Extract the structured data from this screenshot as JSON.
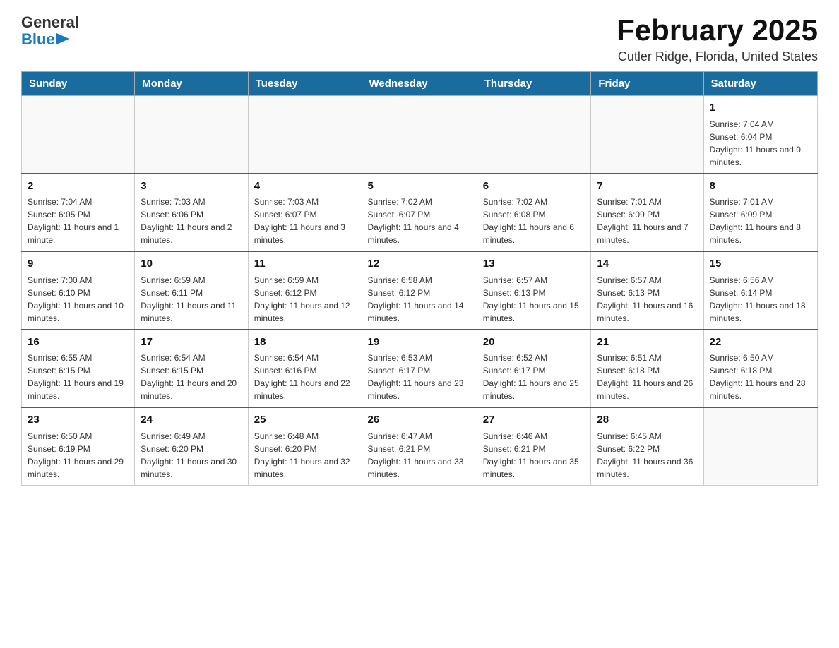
{
  "logo": {
    "text_general": "General",
    "text_blue": "Blue"
  },
  "header": {
    "month_title": "February 2025",
    "subtitle": "Cutler Ridge, Florida, United States"
  },
  "days_of_week": [
    "Sunday",
    "Monday",
    "Tuesday",
    "Wednesday",
    "Thursday",
    "Friday",
    "Saturday"
  ],
  "weeks": [
    {
      "days": [
        {
          "num": "",
          "sunrise": "",
          "sunset": "",
          "daylight": ""
        },
        {
          "num": "",
          "sunrise": "",
          "sunset": "",
          "daylight": ""
        },
        {
          "num": "",
          "sunrise": "",
          "sunset": "",
          "daylight": ""
        },
        {
          "num": "",
          "sunrise": "",
          "sunset": "",
          "daylight": ""
        },
        {
          "num": "",
          "sunrise": "",
          "sunset": "",
          "daylight": ""
        },
        {
          "num": "",
          "sunrise": "",
          "sunset": "",
          "daylight": ""
        },
        {
          "num": "1",
          "sunrise": "Sunrise: 7:04 AM",
          "sunset": "Sunset: 6:04 PM",
          "daylight": "Daylight: 11 hours and 0 minutes."
        }
      ]
    },
    {
      "days": [
        {
          "num": "2",
          "sunrise": "Sunrise: 7:04 AM",
          "sunset": "Sunset: 6:05 PM",
          "daylight": "Daylight: 11 hours and 1 minute."
        },
        {
          "num": "3",
          "sunrise": "Sunrise: 7:03 AM",
          "sunset": "Sunset: 6:06 PM",
          "daylight": "Daylight: 11 hours and 2 minutes."
        },
        {
          "num": "4",
          "sunrise": "Sunrise: 7:03 AM",
          "sunset": "Sunset: 6:07 PM",
          "daylight": "Daylight: 11 hours and 3 minutes."
        },
        {
          "num": "5",
          "sunrise": "Sunrise: 7:02 AM",
          "sunset": "Sunset: 6:07 PM",
          "daylight": "Daylight: 11 hours and 4 minutes."
        },
        {
          "num": "6",
          "sunrise": "Sunrise: 7:02 AM",
          "sunset": "Sunset: 6:08 PM",
          "daylight": "Daylight: 11 hours and 6 minutes."
        },
        {
          "num": "7",
          "sunrise": "Sunrise: 7:01 AM",
          "sunset": "Sunset: 6:09 PM",
          "daylight": "Daylight: 11 hours and 7 minutes."
        },
        {
          "num": "8",
          "sunrise": "Sunrise: 7:01 AM",
          "sunset": "Sunset: 6:09 PM",
          "daylight": "Daylight: 11 hours and 8 minutes."
        }
      ]
    },
    {
      "days": [
        {
          "num": "9",
          "sunrise": "Sunrise: 7:00 AM",
          "sunset": "Sunset: 6:10 PM",
          "daylight": "Daylight: 11 hours and 10 minutes."
        },
        {
          "num": "10",
          "sunrise": "Sunrise: 6:59 AM",
          "sunset": "Sunset: 6:11 PM",
          "daylight": "Daylight: 11 hours and 11 minutes."
        },
        {
          "num": "11",
          "sunrise": "Sunrise: 6:59 AM",
          "sunset": "Sunset: 6:12 PM",
          "daylight": "Daylight: 11 hours and 12 minutes."
        },
        {
          "num": "12",
          "sunrise": "Sunrise: 6:58 AM",
          "sunset": "Sunset: 6:12 PM",
          "daylight": "Daylight: 11 hours and 14 minutes."
        },
        {
          "num": "13",
          "sunrise": "Sunrise: 6:57 AM",
          "sunset": "Sunset: 6:13 PM",
          "daylight": "Daylight: 11 hours and 15 minutes."
        },
        {
          "num": "14",
          "sunrise": "Sunrise: 6:57 AM",
          "sunset": "Sunset: 6:13 PM",
          "daylight": "Daylight: 11 hours and 16 minutes."
        },
        {
          "num": "15",
          "sunrise": "Sunrise: 6:56 AM",
          "sunset": "Sunset: 6:14 PM",
          "daylight": "Daylight: 11 hours and 18 minutes."
        }
      ]
    },
    {
      "days": [
        {
          "num": "16",
          "sunrise": "Sunrise: 6:55 AM",
          "sunset": "Sunset: 6:15 PM",
          "daylight": "Daylight: 11 hours and 19 minutes."
        },
        {
          "num": "17",
          "sunrise": "Sunrise: 6:54 AM",
          "sunset": "Sunset: 6:15 PM",
          "daylight": "Daylight: 11 hours and 20 minutes."
        },
        {
          "num": "18",
          "sunrise": "Sunrise: 6:54 AM",
          "sunset": "Sunset: 6:16 PM",
          "daylight": "Daylight: 11 hours and 22 minutes."
        },
        {
          "num": "19",
          "sunrise": "Sunrise: 6:53 AM",
          "sunset": "Sunset: 6:17 PM",
          "daylight": "Daylight: 11 hours and 23 minutes."
        },
        {
          "num": "20",
          "sunrise": "Sunrise: 6:52 AM",
          "sunset": "Sunset: 6:17 PM",
          "daylight": "Daylight: 11 hours and 25 minutes."
        },
        {
          "num": "21",
          "sunrise": "Sunrise: 6:51 AM",
          "sunset": "Sunset: 6:18 PM",
          "daylight": "Daylight: 11 hours and 26 minutes."
        },
        {
          "num": "22",
          "sunrise": "Sunrise: 6:50 AM",
          "sunset": "Sunset: 6:18 PM",
          "daylight": "Daylight: 11 hours and 28 minutes."
        }
      ]
    },
    {
      "days": [
        {
          "num": "23",
          "sunrise": "Sunrise: 6:50 AM",
          "sunset": "Sunset: 6:19 PM",
          "daylight": "Daylight: 11 hours and 29 minutes."
        },
        {
          "num": "24",
          "sunrise": "Sunrise: 6:49 AM",
          "sunset": "Sunset: 6:20 PM",
          "daylight": "Daylight: 11 hours and 30 minutes."
        },
        {
          "num": "25",
          "sunrise": "Sunrise: 6:48 AM",
          "sunset": "Sunset: 6:20 PM",
          "daylight": "Daylight: 11 hours and 32 minutes."
        },
        {
          "num": "26",
          "sunrise": "Sunrise: 6:47 AM",
          "sunset": "Sunset: 6:21 PM",
          "daylight": "Daylight: 11 hours and 33 minutes."
        },
        {
          "num": "27",
          "sunrise": "Sunrise: 6:46 AM",
          "sunset": "Sunset: 6:21 PM",
          "daylight": "Daylight: 11 hours and 35 minutes."
        },
        {
          "num": "28",
          "sunrise": "Sunrise: 6:45 AM",
          "sunset": "Sunset: 6:22 PM",
          "daylight": "Daylight: 11 hours and 36 minutes."
        },
        {
          "num": "",
          "sunrise": "",
          "sunset": "",
          "daylight": ""
        }
      ]
    }
  ]
}
